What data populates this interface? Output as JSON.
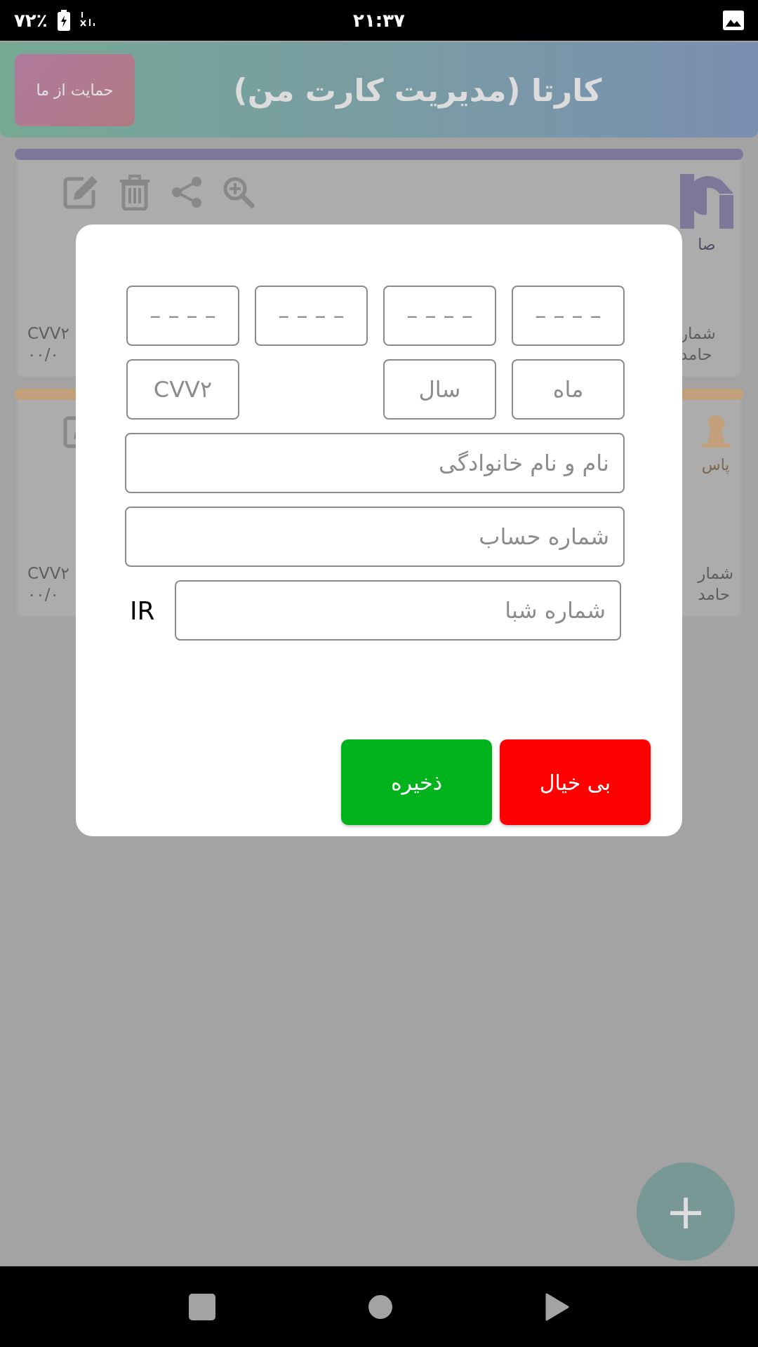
{
  "status_bar": {
    "battery_text": "۷۲٪",
    "time": "۲۱:۳۷"
  },
  "header": {
    "support_button": "حمایت از ما",
    "title": "کارتا (مدیریت کارت من)"
  },
  "cards": [
    {
      "color": "#7f7799",
      "bank_label": "صا",
      "left_lines": [
        "CVV۲",
        "۰۰/۰"
      ],
      "right_lines": [
        "شمار",
        "حامد"
      ]
    },
    {
      "color": "#c3a07c",
      "bank_label": "پاس",
      "left_lines": [
        "CVV۲",
        "۰۰/۰"
      ],
      "right_lines": [
        "شمار",
        "حامد"
      ]
    }
  ],
  "dialog": {
    "card_number_fields": [
      {
        "placeholder": "– – – –"
      },
      {
        "placeholder": "– – – –"
      },
      {
        "placeholder": "– – – –"
      },
      {
        "placeholder": "– – – –"
      }
    ],
    "expiry_month": {
      "placeholder": "ماه"
    },
    "expiry_year": {
      "placeholder": "سال"
    },
    "cvv2": {
      "placeholder": "CVV۲"
    },
    "name": {
      "placeholder": "نام و نام خانوادگی"
    },
    "account": {
      "placeholder": "شماره حساب"
    },
    "sheba": {
      "prefix": "IR",
      "placeholder": "شماره شبا"
    },
    "buttons": [
      {
        "kind": "cancel",
        "label": "بی خیال"
      },
      {
        "kind": "save",
        "label": "ذخیره"
      }
    ]
  },
  "fab": {
    "label": "+"
  }
}
